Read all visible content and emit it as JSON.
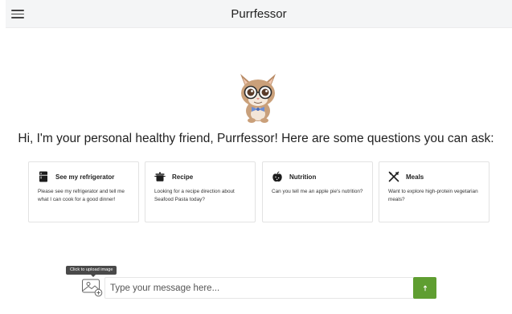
{
  "app": {
    "title": "Purrfessor"
  },
  "header": {
    "menu_icon": "hamburger-menu-icon"
  },
  "mascot": {
    "icon": "cat-mascot-with-glasses"
  },
  "greeting": "Hi, I'm your personal healthy friend, Purrfessor! Here are some questions you can ask:",
  "cards": [
    {
      "icon": "refrigerator-icon",
      "title": "See my refrigerator",
      "description": "Please see my refrigerator and tell me what I can cook for a good dinner!"
    },
    {
      "icon": "cooking-pot-icon",
      "title": "Recipe",
      "description": "Looking for a recipe direction about Seafood Pasta today?"
    },
    {
      "icon": "apple-icon",
      "title": "Nutrition",
      "description": "Can you tell me an apple pie's nutrition?"
    },
    {
      "icon": "fork-knife-icon",
      "title": "Meals",
      "description": "Want to explore high-protein vegetarian meals?"
    }
  ],
  "upload": {
    "tooltip": "Click to upload image",
    "icon": "upload-image-icon"
  },
  "composer": {
    "placeholder": "Type your message here...",
    "value": ""
  },
  "send": {
    "icon": "arrow-up-icon",
    "color": "#5f9e31"
  }
}
